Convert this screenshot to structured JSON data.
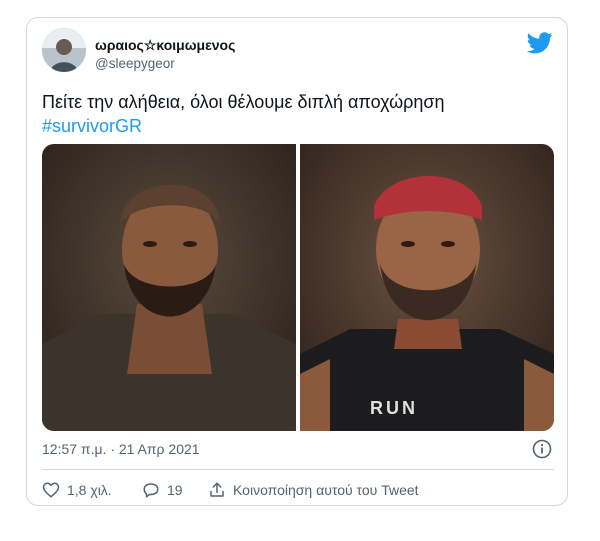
{
  "tweet": {
    "display_name": "ωραιος☆κοιμωμενος",
    "handle": "@sleepygeor",
    "text": "Πείτε την αλήθεια, όλοι θέλουμε διπλή αποχώρηση",
    "hashtag": "#survivorGR",
    "timestamp": "12:57 π.μ. · 21 Απρ 2021",
    "likes": "1,8 χιλ.",
    "replies": "19",
    "share_label": "Κοινοποίηση αυτού του Tweet"
  },
  "icons": {
    "brand": "twitter-bird-icon",
    "info": "info-icon",
    "like": "heart-icon",
    "reply": "reply-bubble-icon",
    "share": "share-icon"
  },
  "colors": {
    "accent": "#1d9bf0",
    "text": "#0f1419",
    "muted": "#536471",
    "border": "#cfd9de"
  },
  "media": {
    "shirt_print": "RUN"
  }
}
